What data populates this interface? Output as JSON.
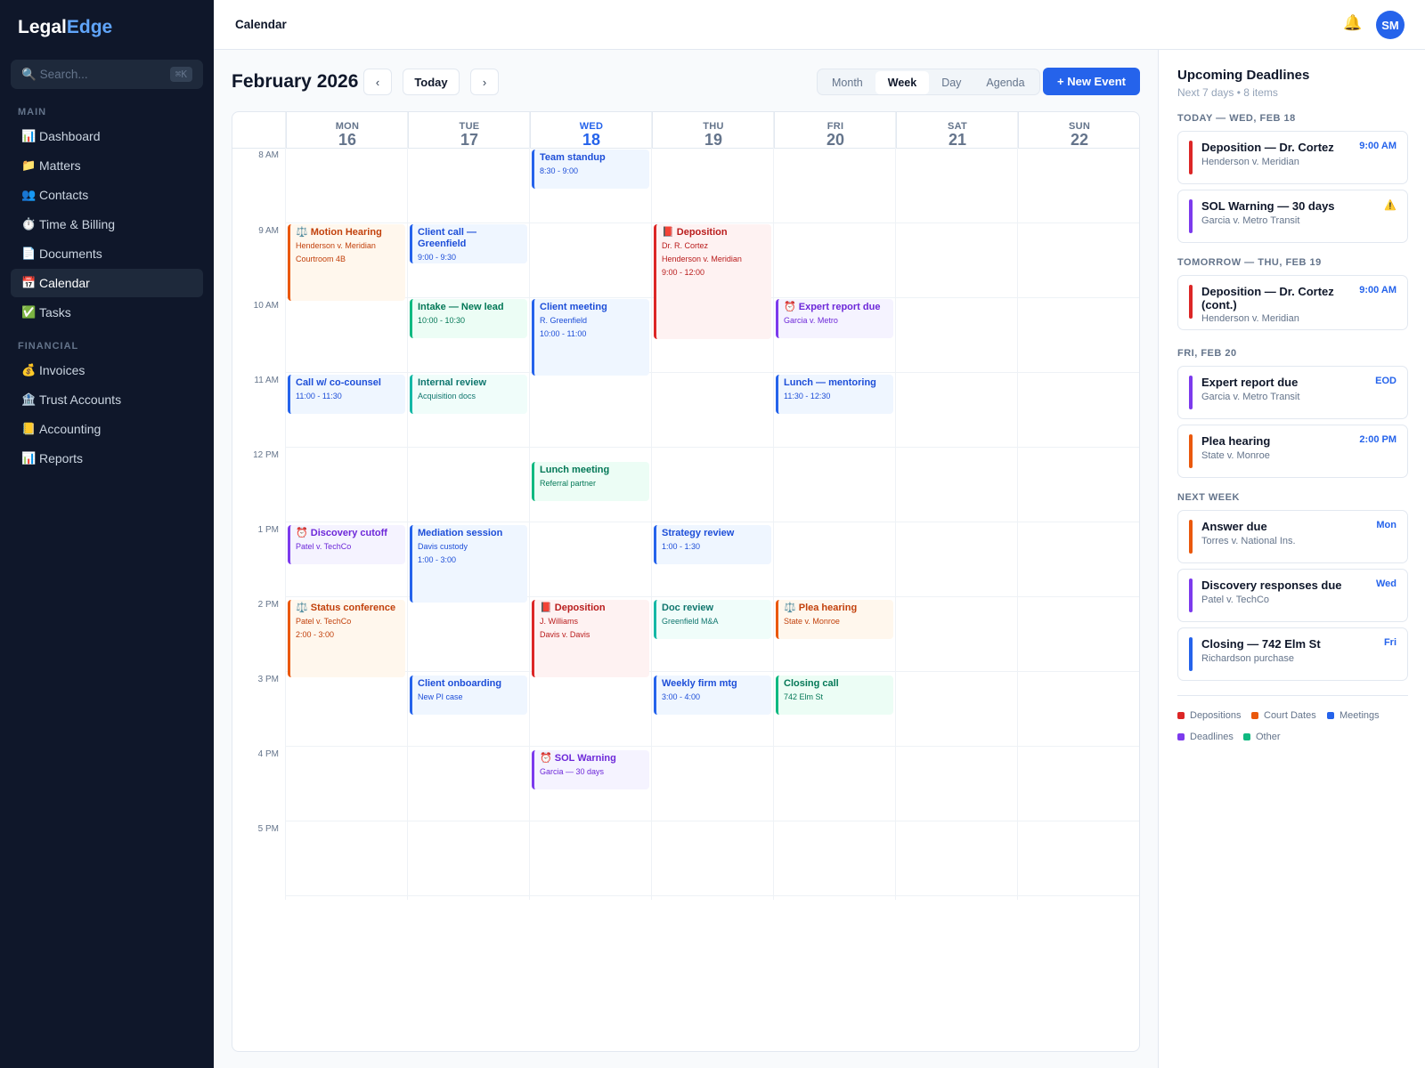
{
  "app": {
    "brand_main": "Legal",
    "brand_accent": "Edge"
  },
  "search": {
    "placeholder": "Search...",
    "shortcut": "⌘K"
  },
  "sidebar": {
    "main_label": "MAIN",
    "financial_label": "FINANCIAL",
    "items": [
      {
        "icon": "📊",
        "label": "Dashboard"
      },
      {
        "icon": "📁",
        "label": "Matters"
      },
      {
        "icon": "👥",
        "label": "Contacts"
      },
      {
        "icon": "⏱️",
        "label": "Time & Billing"
      },
      {
        "icon": "📄",
        "label": "Documents"
      },
      {
        "icon": "📅",
        "label": "Calendar"
      },
      {
        "icon": "✅",
        "label": "Tasks"
      }
    ],
    "financial_items": [
      {
        "icon": "💰",
        "label": "Invoices"
      },
      {
        "icon": "🏦",
        "label": "Trust Accounts"
      },
      {
        "icon": "📒",
        "label": "Accounting"
      },
      {
        "icon": "📊",
        "label": "Reports"
      }
    ]
  },
  "topbar": {
    "title": "Calendar",
    "bell": "🔔",
    "avatar": "SM"
  },
  "toolbar": {
    "month_title": "February 2026",
    "prev": "‹",
    "today": "Today",
    "next": "›",
    "views": [
      "Month",
      "Week",
      "Day",
      "Agenda"
    ],
    "active_view": "Week",
    "new_event": "+ New Event"
  },
  "calendar": {
    "days": [
      {
        "name": "MON",
        "date": "16"
      },
      {
        "name": "TUE",
        "date": "17"
      },
      {
        "name": "WED",
        "date": "18"
      },
      {
        "name": "THU",
        "date": "19"
      },
      {
        "name": "FRI",
        "date": "20"
      },
      {
        "name": "SAT",
        "date": "21"
      },
      {
        "name": "SUN",
        "date": "22"
      }
    ],
    "today": "18",
    "times": [
      "8 AM",
      "9 AM",
      "10 AM",
      "11 AM",
      "12 PM",
      "1 PM",
      "2 PM",
      "3 PM",
      "4 PM",
      "5 PM"
    ],
    "events": [
      {
        "title": "Team standup",
        "lines": [
          "8:30 - 9:00"
        ]
      },
      {
        "title": "⚖️ Motion Hearing",
        "lines": [
          "Henderson v. Meridian",
          "Courtroom 4B"
        ]
      },
      {
        "title": "Client call — Greenfield",
        "lines": [
          "9:00 - 9:30"
        ]
      },
      {
        "title": "📕 Deposition",
        "lines": [
          "Dr. R. Cortez",
          "Henderson v. Meridian",
          "9:00 - 12:00"
        ]
      },
      {
        "title": "Intake — New lead",
        "lines": [
          "10:00 - 10:30"
        ]
      },
      {
        "title": "Client meeting",
        "lines": [
          "R. Greenfield",
          "10:00 - 11:00"
        ]
      },
      {
        "title": "⏰ Expert report due",
        "lines": [
          "Garcia v. Metro"
        ]
      },
      {
        "title": "Call w/ co-counsel",
        "lines": [
          "11:00 - 11:30"
        ]
      },
      {
        "title": "Internal review",
        "lines": [
          "Acquisition docs"
        ]
      },
      {
        "title": "Lunch — mentoring",
        "lines": [
          "11:30 - 12:30"
        ]
      },
      {
        "title": "Lunch meeting",
        "lines": [
          "Referral partner"
        ]
      },
      {
        "title": "⏰ Discovery cutoff",
        "lines": [
          "Patel v. TechCo"
        ]
      },
      {
        "title": "Mediation session",
        "lines": [
          "Davis custody",
          "1:00 - 3:00"
        ]
      },
      {
        "title": "Strategy review",
        "lines": [
          "1:00 - 1:30"
        ]
      },
      {
        "title": "⚖️ Status conference",
        "lines": [
          "Patel v. TechCo",
          "2:00 - 3:00"
        ]
      },
      {
        "title": "📕 Deposition",
        "lines": [
          "J. Williams",
          "Davis v. Davis"
        ]
      },
      {
        "title": "Doc review",
        "lines": [
          "Greenfield M&A"
        ]
      },
      {
        "title": "⚖️ Plea hearing",
        "lines": [
          "State v. Monroe"
        ]
      },
      {
        "title": "Client onboarding",
        "lines": [
          "New PI case"
        ]
      },
      {
        "title": "Weekly firm mtg",
        "lines": [
          "3:00 - 4:00"
        ]
      },
      {
        "title": "Closing call",
        "lines": [
          "742 Elm St"
        ]
      },
      {
        "title": "⏰ SOL Warning",
        "lines": [
          "Garcia — 30 days"
        ]
      }
    ]
  },
  "deadlines": {
    "title": "Upcoming Deadlines",
    "subtitle": "Next 7 days • 8 items",
    "groups": [
      {
        "label": "TODAY — WED, FEB 18",
        "items": [
          {
            "title": "Deposition — Dr. Cortez",
            "sub": "Henderson v. Meridian",
            "time": "9:00 AM",
            "color": "#dc2626"
          },
          {
            "title": "SOL Warning — 30 days",
            "sub": "Garcia v. Metro Transit",
            "time": "⚠️",
            "color": "#7c3aed"
          }
        ]
      },
      {
        "label": "TOMORROW — THU, FEB 19",
        "items": [
          {
            "title": "Deposition — Dr. Cortez (cont.)",
            "sub": "Henderson v. Meridian",
            "time": "9:00 AM",
            "color": "#dc2626"
          }
        ]
      },
      {
        "label": "FRI, FEB 20",
        "items": [
          {
            "title": "Expert report due",
            "sub": "Garcia v. Metro Transit",
            "time": "EOD",
            "color": "#7c3aed"
          },
          {
            "title": "Plea hearing",
            "sub": "State v. Monroe",
            "time": "2:00 PM",
            "color": "#ea580c"
          }
        ]
      },
      {
        "label": "NEXT WEEK",
        "items": [
          {
            "title": "Answer due",
            "sub": "Torres v. National Ins.",
            "time": "Mon",
            "color": "#ea580c"
          },
          {
            "title": "Discovery responses due",
            "sub": "Patel v. TechCo",
            "time": "Wed",
            "color": "#7c3aed"
          },
          {
            "title": "Closing — 742 Elm St",
            "sub": "Richardson purchase",
            "time": "Fri",
            "color": "#2563eb"
          }
        ]
      }
    ],
    "legend": [
      {
        "label": "Depositions",
        "color": "#dc2626"
      },
      {
        "label": "Court Dates",
        "color": "#ea580c"
      },
      {
        "label": "Meetings",
        "color": "#2563eb"
      },
      {
        "label": "Deadlines",
        "color": "#7c3aed"
      },
      {
        "label": "Other",
        "color": "#10b981"
      }
    ]
  }
}
